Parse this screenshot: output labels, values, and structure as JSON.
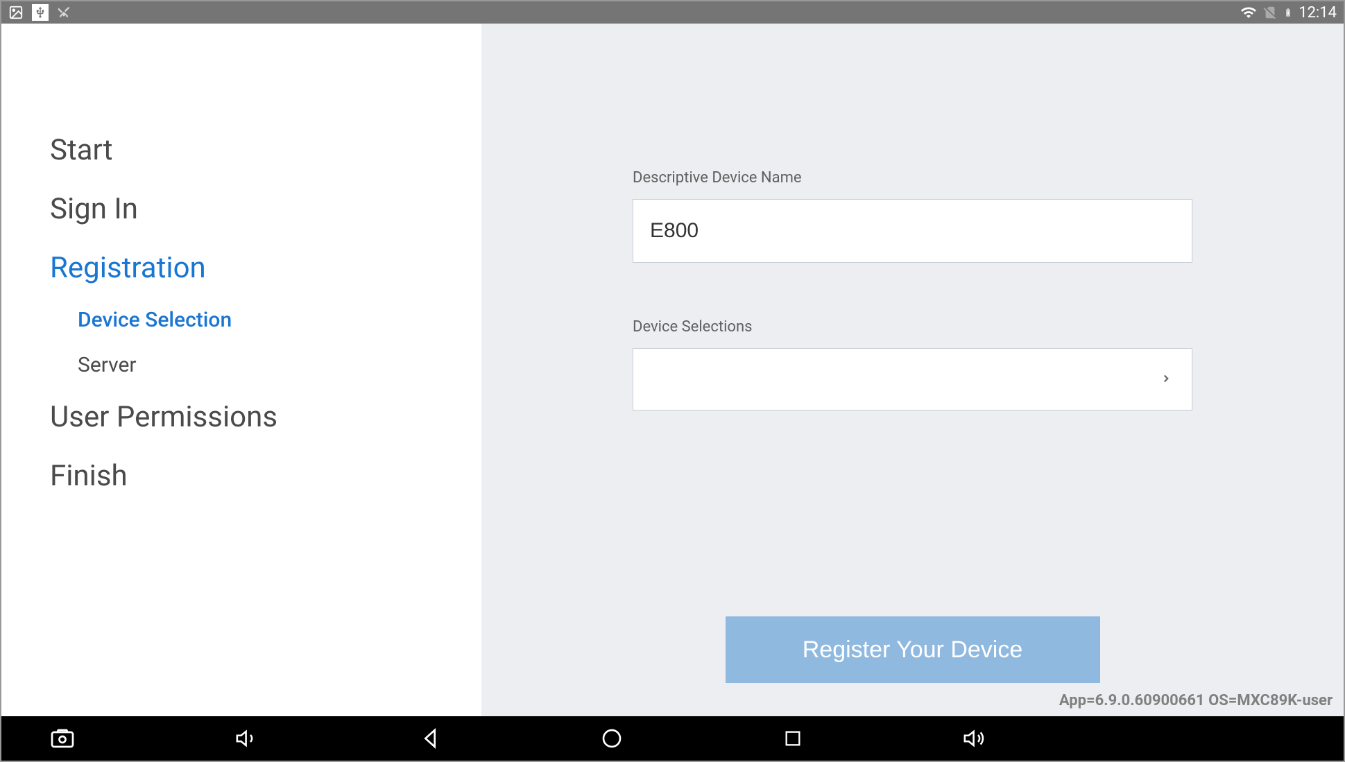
{
  "statusBar": {
    "time": "12:14",
    "icons": {
      "image": "image-icon",
      "usb": "usb-icon",
      "cut": "scissors-icon",
      "wifi": "wifi-icon",
      "sim": "sim-disabled-icon",
      "battery": "battery-icon"
    }
  },
  "sidebar": {
    "items": [
      {
        "label": "Start",
        "active": false
      },
      {
        "label": "Sign In",
        "active": false
      },
      {
        "label": "Registration",
        "active": true,
        "subItems": [
          {
            "label": "Device Selection",
            "active": true
          },
          {
            "label": "Server",
            "active": false
          }
        ]
      },
      {
        "label": "User Permissions",
        "active": false
      },
      {
        "label": "Finish",
        "active": false
      }
    ]
  },
  "form": {
    "deviceNameLabel": "Descriptive Device Name",
    "deviceNameValue": "E800",
    "selectionsLabel": "Device Selections",
    "selectionsValue": "",
    "registerButton": "Register Your Device"
  },
  "footer": {
    "versionInfo": "App=6.9.0.60900661 OS=MXC89K-user"
  },
  "bottomNav": {
    "camera": "camera-icon",
    "volumeDown": "volume-down-icon",
    "back": "back-icon",
    "home": "home-icon",
    "recent": "recent-icon",
    "volumeUp": "volume-up-icon"
  }
}
